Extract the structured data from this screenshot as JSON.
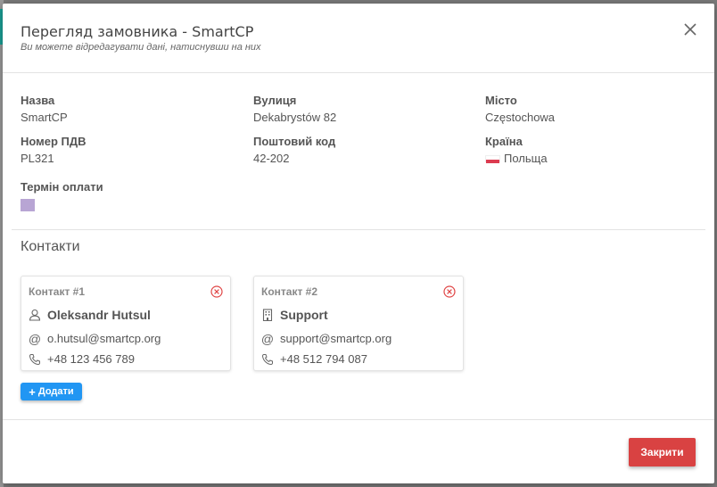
{
  "modal": {
    "title": "Перегляд замовника - SmartCP",
    "subtitle": "Ви можете відредагувати дані, натиснувши на них"
  },
  "fields": {
    "name": {
      "label": "Назва",
      "value": "SmartCP"
    },
    "street": {
      "label": "Вулиця",
      "value": "Dekabrystów 82"
    },
    "city": {
      "label": "Місто",
      "value": "Częstochowa"
    },
    "vat": {
      "label": "Номер ПДВ",
      "value": "PL321"
    },
    "postal": {
      "label": "Поштовий код",
      "value": "42-202"
    },
    "country": {
      "label": "Країна",
      "value": "Польща"
    },
    "payment_term": {
      "label": "Термін оплати"
    }
  },
  "contacts": {
    "title": "Контакти",
    "items": [
      {
        "number": "Контакт #1",
        "name": "Oleksandr Hutsul",
        "name_icon": "user-icon",
        "email": "o.hutsul@smartcp.org",
        "phone": "+48 123 456 789"
      },
      {
        "number": "Контакт #2",
        "name": "Support",
        "name_icon": "building-icon",
        "email": "support@smartcp.org",
        "phone": "+48 512 794 087"
      }
    ],
    "add_label": "Додати"
  },
  "footer": {
    "close_label": "Закрити"
  },
  "colors": {
    "add_button": "#2196f3",
    "close_button": "#d94242",
    "remove_icon": "#e04646",
    "term_swatch": "#b8a5d4",
    "flag_red": "#dc3b50"
  }
}
